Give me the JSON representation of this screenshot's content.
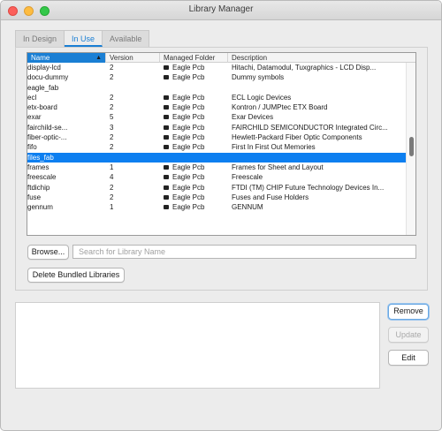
{
  "window": {
    "title": "Library Manager"
  },
  "tabs": [
    {
      "label": "In Design",
      "active": false
    },
    {
      "label": "In Use",
      "active": true
    },
    {
      "label": "Available",
      "active": false
    }
  ],
  "table": {
    "columns": [
      "Name",
      "Version",
      "Managed Folder",
      "Description"
    ],
    "sorted_column": "Name",
    "sort_direction": "ascending",
    "selected_row": "files_fab",
    "rows": [
      {
        "name": "display-lcd",
        "version": "2",
        "folder": "Eagle Pcb",
        "desc": "Hitachi, Datamodul, Tuxgraphics - LCD Disp..."
      },
      {
        "name": "docu-dummy",
        "version": "2",
        "folder": "Eagle Pcb",
        "desc": "Dummy symbols"
      },
      {
        "name": "eagle_fab",
        "version": "",
        "folder": "",
        "desc": ""
      },
      {
        "name": "ecl",
        "version": "2",
        "folder": "Eagle Pcb",
        "desc": "ECL Logic Devices"
      },
      {
        "name": "etx-board",
        "version": "2",
        "folder": "Eagle Pcb",
        "desc": "Kontron / JUMPtec ETX Board"
      },
      {
        "name": "exar",
        "version": "5",
        "folder": "Eagle Pcb",
        "desc": "Exar Devices"
      },
      {
        "name": "fairchild-se...",
        "version": "3",
        "folder": "Eagle Pcb",
        "desc": "FAIRCHILD SEMICONDUCTOR Integrated Circ..."
      },
      {
        "name": "fiber-optic-...",
        "version": "2",
        "folder": "Eagle Pcb",
        "desc": "Hewlett-Packard Fiber Optic Components"
      },
      {
        "name": "fifo",
        "version": "2",
        "folder": "Eagle Pcb",
        "desc": "First In First Out Memories"
      },
      {
        "name": "files_fab",
        "version": "",
        "folder": "",
        "desc": ""
      },
      {
        "name": "frames",
        "version": "1",
        "folder": "Eagle Pcb",
        "desc": "Frames for Sheet and Layout"
      },
      {
        "name": "freescale",
        "version": "4",
        "folder": "Eagle Pcb",
        "desc": "Freescale"
      },
      {
        "name": "ftdichip",
        "version": "2",
        "folder": "Eagle Pcb",
        "desc": "FTDI (TM) CHIP Future Technology Devices In..."
      },
      {
        "name": "fuse",
        "version": "2",
        "folder": "Eagle Pcb",
        "desc": "Fuses and Fuse Holders"
      },
      {
        "name": "gennum",
        "version": "1",
        "folder": "Eagle Pcb",
        "desc": "GENNUM"
      }
    ]
  },
  "controls": {
    "browse_label": "Browse...",
    "search_placeholder": "Search for Library Name",
    "delete_label": "Delete Bundled Libraries",
    "remove_label": "Remove",
    "update_label": "Update",
    "edit_label": "Edit"
  },
  "colors": {
    "accent": "#1a7fd4",
    "selection": "#0d7ff0"
  }
}
